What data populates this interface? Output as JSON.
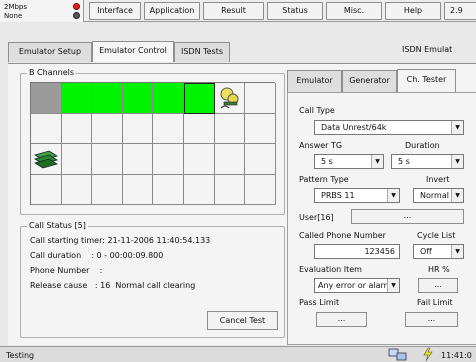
{
  "status": {
    "line1": "2Mbps",
    "line2": "None"
  },
  "menu": [
    "Interface",
    "Application",
    "Result",
    "Status",
    "Misc.",
    "Help",
    "2.9"
  ],
  "subtabs": {
    "setup": "Emulator Setup",
    "control": "Emulator Control",
    "isdn": "ISDN Tests",
    "right_title": "ISDN Emulat"
  },
  "bchannels": {
    "title": "B Channels",
    "row1": [
      "grey",
      "green",
      "green",
      "green",
      "green",
      "green",
      "sel",
      "empty"
    ]
  },
  "call_status": {
    "title": "Call Status [5]",
    "starting_timer": "Call starting timer: 21-11-2006 11:40:54.133",
    "duration": "Call duration    : 0 - 00:00:09.800",
    "phone": "Phone Number    :",
    "release": "Release cause   : 16  Normal call clearing",
    "cancel_button": "Cancel Test"
  },
  "right_tabs": {
    "emulator": "Emulator",
    "generator": "Generator",
    "tester": "Ch. Tester"
  },
  "tester": {
    "call_type_label": "Call Type",
    "call_type_value": "Data Unrest/64k",
    "answer_tg_label": "Answer TG",
    "answer_tg_value": "5 s",
    "duration_label": "Duration",
    "duration_value": "5 s",
    "pattern_label": "Pattern Type",
    "pattern_value": "PRBS 11",
    "invert_label": "Invert",
    "invert_value": "Normal",
    "user_label": "User[16]",
    "user_button": "...",
    "called_label": "Called Phone Number",
    "called_value": "123456",
    "cycle_label": "Cycle List",
    "cycle_value": "Off",
    "eval_label": "Evaluation Item",
    "eval_value": "Any error or alarm",
    "hr_label": "HR %",
    "hr_button": "...",
    "pass_label": "Pass Limit",
    "pass_button": "...",
    "fail_label": "Fail Limit",
    "fail_button": "..."
  },
  "statusbar": {
    "text": "Testing",
    "clock": "11:41:0"
  },
  "colors": {
    "green": "#00f400",
    "led": "#e21b1b"
  }
}
